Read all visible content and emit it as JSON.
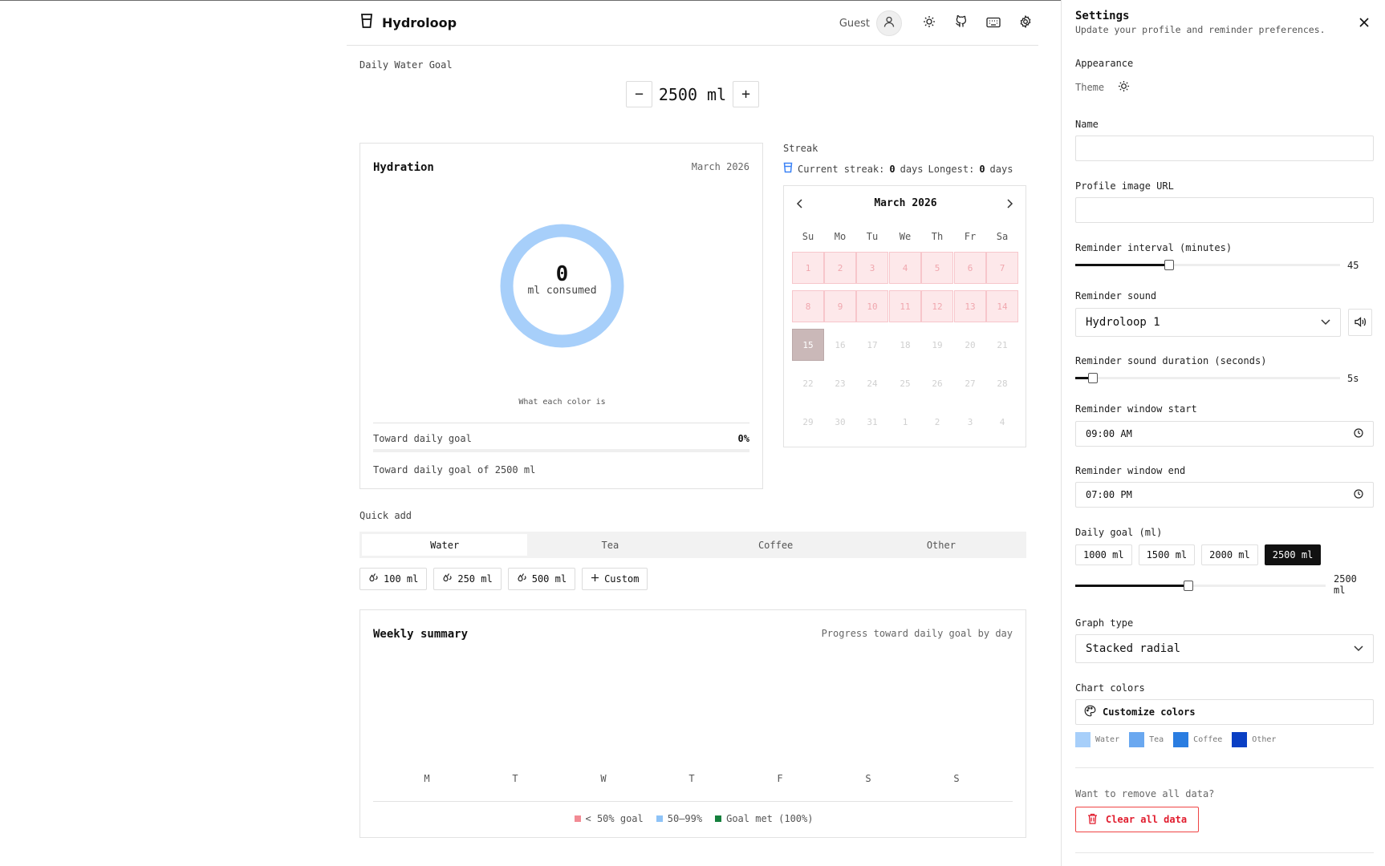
{
  "app": {
    "name": "Hydroloop"
  },
  "header": {
    "user_label": "Guest"
  },
  "goal": {
    "label": "Daily Water Goal",
    "value": "2500 ml",
    "minus": "−",
    "plus": "+"
  },
  "hydration": {
    "title": "Hydration",
    "month": "March 2026",
    "consumed_value": "0",
    "consumed_label": "ml consumed",
    "legend_link": "What each color is",
    "toward_label": "Toward daily goal",
    "percent": "0%",
    "progress": 0,
    "goal_text": "Toward daily goal of 2500 ml",
    "ring_color": "#a7cffa"
  },
  "streak": {
    "label": "Streak",
    "current_label": "Current streak:",
    "current_value": "0",
    "days_word": "days",
    "longest_label": "Longest:",
    "longest_value": "0"
  },
  "calendar": {
    "month": "March 2026",
    "weekdays": [
      "Su",
      "Mo",
      "Tu",
      "We",
      "Th",
      "Fr",
      "Sa"
    ],
    "weeks": [
      [
        "1",
        "2",
        "3",
        "4",
        "5",
        "6",
        "7"
      ],
      [
        "8",
        "9",
        "10",
        "11",
        "12",
        "13",
        "14"
      ],
      [
        "15",
        "16",
        "17",
        "18",
        "19",
        "20",
        "21"
      ],
      [
        "22",
        "23",
        "24",
        "25",
        "26",
        "27",
        "28"
      ],
      [
        "29",
        "30",
        "31",
        "1",
        "2",
        "3",
        "4"
      ]
    ],
    "missed_through": 14,
    "today_index": 14
  },
  "quick_add": {
    "label": "Quick add",
    "tabs": [
      "Water",
      "Tea",
      "Coffee",
      "Other"
    ],
    "active_tab": 0,
    "amounts": [
      "100 ml",
      "250 ml",
      "500 ml"
    ],
    "custom": "Custom"
  },
  "weekly": {
    "title": "Weekly summary",
    "subtitle": "Progress toward daily goal by day",
    "days": [
      "M",
      "T",
      "W",
      "T",
      "F",
      "S",
      "S"
    ],
    "legend": [
      {
        "label": "< 50% goal",
        "color": "#f28b94"
      },
      {
        "label": "50–99%",
        "color": "#8ec3f7"
      },
      {
        "label": "Goal met (100%)",
        "color": "#15803d"
      }
    ]
  },
  "settings": {
    "title": "Settings",
    "subtitle": "Update your profile and reminder preferences.",
    "appearance_label": "Appearance",
    "theme_label": "Theme",
    "name_label": "Name",
    "name_value": "",
    "image_label": "Profile image URL",
    "image_value": "",
    "interval_label": "Reminder interval (minutes)",
    "interval_value": "45",
    "interval_fraction": 0.35,
    "sound_label": "Reminder sound",
    "sound_value": "Hydroloop 1",
    "duration_label": "Reminder sound duration (seconds)",
    "duration_value": "5s",
    "duration_fraction": 0.05,
    "window_start_label": "Reminder window start",
    "window_start_value": "09:00 AM",
    "window_end_label": "Reminder window end",
    "window_end_value": "07:00 PM",
    "goal_label": "Daily goal (ml)",
    "goal_options": [
      "1000 ml",
      "1500 ml",
      "2000 ml",
      "2500 ml"
    ],
    "goal_selected": 3,
    "goal_slider_value_line1": "2500",
    "goal_slider_value_line2": "ml",
    "goal_fraction": 0.45,
    "graph_label": "Graph type",
    "graph_value": "Stacked radial",
    "colors_label": "Chart colors",
    "customize_label": "Customize colors",
    "swatches": [
      {
        "label": "Water",
        "color": "#a7cffa"
      },
      {
        "label": "Tea",
        "color": "#6aa8f0"
      },
      {
        "label": "Coffee",
        "color": "#2a7de1"
      },
      {
        "label": "Other",
        "color": "#0a3fc4"
      }
    ],
    "remove_question": "Want to remove all data?",
    "clear_label": "Clear all data",
    "danger_color": "#e11d2e"
  }
}
